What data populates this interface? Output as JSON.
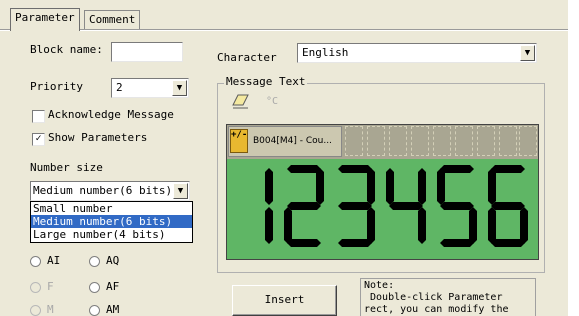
{
  "tabs": [
    {
      "label": "Parameter",
      "active": true
    },
    {
      "label": "Comment",
      "active": false
    }
  ],
  "left": {
    "block_name_label": "Block name:",
    "block_name_value": "",
    "priority_label": "Priority",
    "priority_value": "2",
    "acknowledge_label": "Acknowledge Message",
    "acknowledge_checked": false,
    "show_params_label": "Show Parameters",
    "show_params_checked": true,
    "number_size_label": "Number size",
    "number_size_value": "Medium number(6 bits)",
    "number_size_options": [
      "Small number",
      "Medium number(6 bits)",
      "Large number(4 bits)"
    ],
    "radios": [
      {
        "label": "AI",
        "enabled": true
      },
      {
        "label": "AQ",
        "enabled": true
      },
      {
        "label": "F",
        "enabled": false
      },
      {
        "label": "AF",
        "enabled": true
      },
      {
        "label": "M",
        "enabled": false
      },
      {
        "label": "AM",
        "enabled": true
      }
    ]
  },
  "right": {
    "character_label": "Character",
    "character_value": "English",
    "message_text_label": "Message Text",
    "toolbar_degree": "°C",
    "block_label": "B004[M4] - Cou...",
    "block_icon_text": "+/-",
    "display_digits": "123456",
    "insert_label": "Insert",
    "note_text": "Note:\n Double-click Parameter\nrect, you can modify the"
  },
  "colors": {
    "dialog_bg": "#ece9d8",
    "display_green": "#5fb665",
    "selection_blue": "#316ac5",
    "block_icon": "#e8b830"
  },
  "icons": {
    "dropdown": "chevron-down-icon",
    "eraser": "eraser-icon",
    "block": "function-block-icon"
  }
}
